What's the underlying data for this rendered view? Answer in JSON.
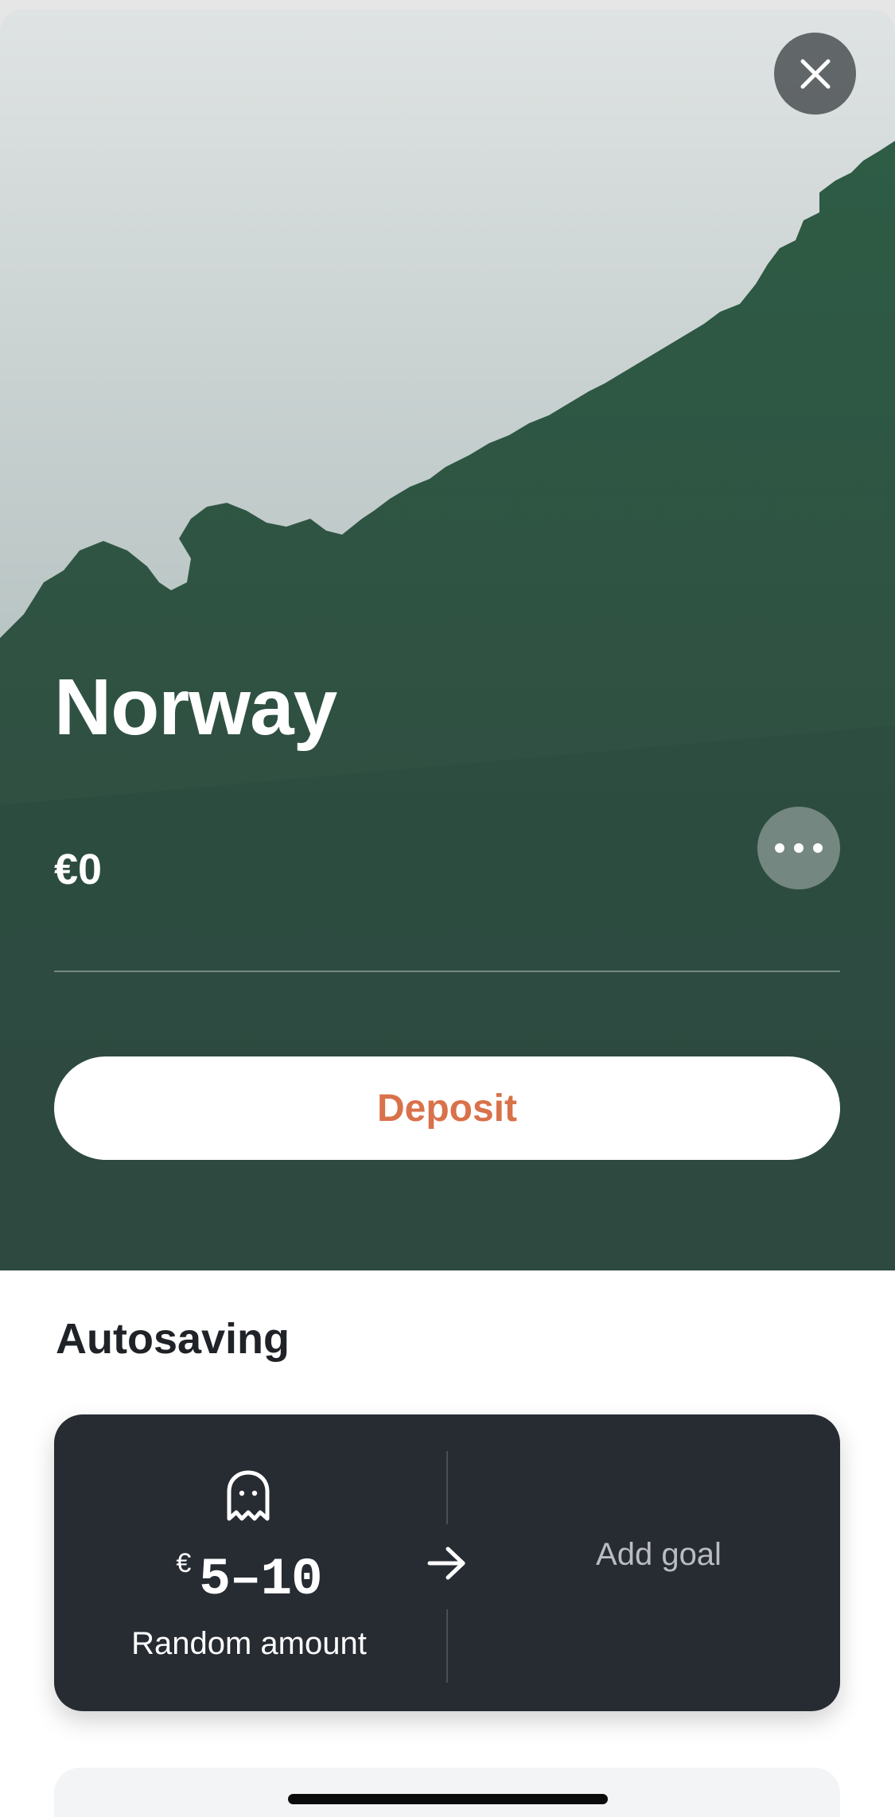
{
  "header": {
    "close_icon": "close-icon"
  },
  "goal": {
    "title": "Norway",
    "balance": "€0",
    "more_icon": "more-horizontal-icon",
    "deposit_label": "Deposit"
  },
  "autosaving": {
    "section_title": "Autosaving",
    "rule": {
      "icon": "ghost-icon",
      "currency": "€",
      "amount": "5–10",
      "label": "Random amount"
    },
    "arrow_icon": "arrow-right-icon",
    "add_goal_label": "Add goal"
  },
  "colors": {
    "accent": "#d9714a",
    "card_dark": "#272b32",
    "hero_green": "#2f4b42"
  }
}
